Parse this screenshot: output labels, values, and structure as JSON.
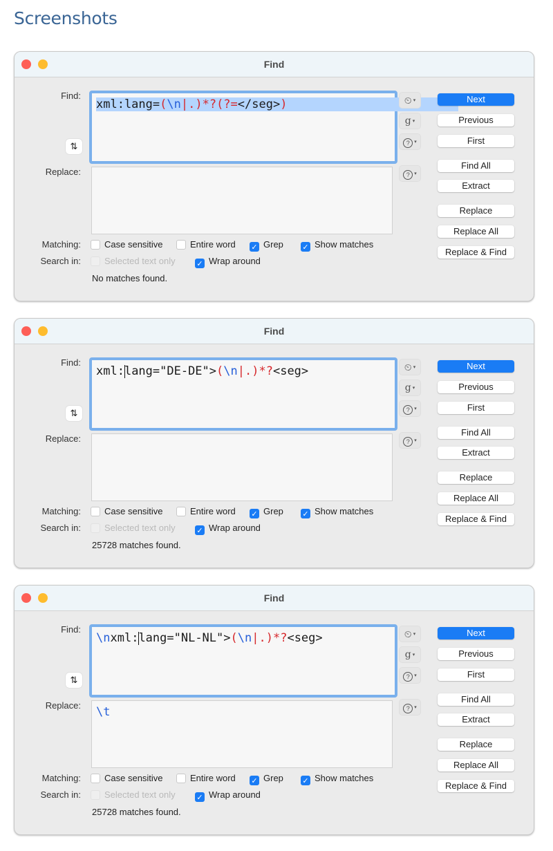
{
  "page": {
    "heading": "Screenshots"
  },
  "colors": {
    "accent": "#1a7cf5",
    "regex_red": "#d6282c",
    "regex_blue": "#2760d9",
    "focus_ring": "#7ab0ec",
    "heading": "#3a6595"
  },
  "dialogs": [
    {
      "window_title": "Find",
      "labels": {
        "find": "Find:",
        "replace": "Replace:",
        "matching": "Matching:",
        "search_in": "Search in:"
      },
      "find_value": "xml:lang=(\\n|.)*?(?=</seg>)",
      "find_tokens": [
        {
          "text": "xml:lang=",
          "role": "plain"
        },
        {
          "text": "(",
          "role": "red"
        },
        {
          "text": "\\n",
          "role": "blue"
        },
        {
          "text": "|",
          "role": "red"
        },
        {
          "text": ".",
          "role": "red"
        },
        {
          "text": ")*?(?=",
          "role": "red"
        },
        {
          "text": "</seg>",
          "role": "plain"
        },
        {
          "text": ")",
          "role": "red"
        }
      ],
      "find_selected": true,
      "replace_value": "",
      "options": {
        "case_sensitive": false,
        "entire_word": false,
        "grep": true,
        "show_matches": true,
        "selected_text_only": false,
        "selected_text_only_disabled": true,
        "wrap_around": true
      },
      "status": "No matches found."
    },
    {
      "window_title": "Find",
      "labels": {
        "find": "Find:",
        "replace": "Replace:",
        "matching": "Matching:",
        "search_in": "Search in:"
      },
      "find_value": "xml:lang=\"DE-DE\">(\\n|.)*?<seg>",
      "find_tokens": [
        {
          "text": "xml:",
          "role": "plain"
        },
        {
          "text": "lang=\"DE-DE\">",
          "role": "plain",
          "caret_before": true
        },
        {
          "text": "(",
          "role": "red"
        },
        {
          "text": "\\n",
          "role": "blue"
        },
        {
          "text": "|",
          "role": "red"
        },
        {
          "text": ".",
          "role": "red"
        },
        {
          "text": ")*?",
          "role": "red"
        },
        {
          "text": "<seg>",
          "role": "plain"
        }
      ],
      "find_selected": false,
      "replace_value": "",
      "options": {
        "case_sensitive": false,
        "entire_word": false,
        "grep": true,
        "show_matches": true,
        "selected_text_only": false,
        "selected_text_only_disabled": true,
        "wrap_around": true
      },
      "status": "25728 matches found."
    },
    {
      "window_title": "Find",
      "labels": {
        "find": "Find:",
        "replace": "Replace:",
        "matching": "Matching:",
        "search_in": "Search in:"
      },
      "find_value": "\\nxml:lang=\"NL-NL\">(\\n|.)*?<seg>",
      "find_tokens": [
        {
          "text": "\\n",
          "role": "blue"
        },
        {
          "text": "xml:",
          "role": "plain"
        },
        {
          "text": "lang=\"NL-NL\">",
          "role": "plain",
          "caret_before": true
        },
        {
          "text": "(",
          "role": "red"
        },
        {
          "text": "\\n",
          "role": "blue"
        },
        {
          "text": "|",
          "role": "red"
        },
        {
          "text": ".",
          "role": "red"
        },
        {
          "text": ")*?",
          "role": "red"
        },
        {
          "text": "<seg>",
          "role": "plain"
        }
      ],
      "find_selected": false,
      "replace_value": "\\t",
      "replace_tokens": [
        {
          "text": "\\t",
          "role": "blue"
        }
      ],
      "options": {
        "case_sensitive": false,
        "entire_word": false,
        "grep": true,
        "show_matches": true,
        "selected_text_only": false,
        "selected_text_only_disabled": true,
        "wrap_around": true
      },
      "status": "25728 matches found."
    }
  ],
  "option_labels": {
    "case_sensitive": "Case sensitive",
    "entire_word": "Entire word",
    "grep": "Grep",
    "show_matches": "Show matches",
    "selected_text_only": "Selected text only",
    "wrap_around": "Wrap around"
  },
  "buttons": {
    "next": "Next",
    "previous": "Previous",
    "first": "First",
    "find_all": "Find All",
    "extract": "Extract",
    "replace": "Replace",
    "replace_all": "Replace All",
    "replace_and_find": "Replace & Find"
  },
  "icons": {
    "recent": {
      "name": "clock-icon",
      "glyph": "⏲"
    },
    "grep_patterns": {
      "name": "grep-g-icon",
      "glyph": "g"
    },
    "help": {
      "name": "help-icon",
      "glyph": "?"
    },
    "swap": {
      "name": "swap-arrows-icon",
      "glyph": "⇅"
    },
    "dropdown": {
      "name": "dropdown-arrow-icon",
      "glyph": "▾"
    },
    "check": {
      "name": "checkmark-icon",
      "glyph": "✓"
    }
  }
}
